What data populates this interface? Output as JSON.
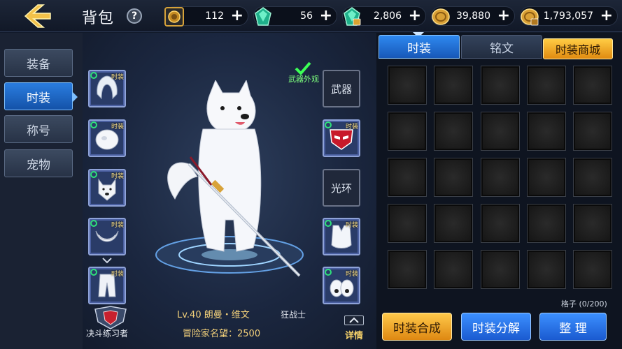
{
  "header": {
    "title": "背包",
    "help_label": "?",
    "currencies": [
      {
        "icon": "coin-badge-icon",
        "value": "112"
      },
      {
        "icon": "green-gem-icon",
        "value": "56"
      },
      {
        "icon": "bound-green-gem-icon",
        "value": "2,806"
      },
      {
        "icon": "gold-coin-icon",
        "value": "39,880"
      },
      {
        "icon": "bound-gold-coin-icon",
        "value": "1,793,057"
      }
    ],
    "plus_label": "+"
  },
  "nav": {
    "items": [
      {
        "label": "装备",
        "active": false
      },
      {
        "label": "时装",
        "active": true
      },
      {
        "label": "称号",
        "active": false
      },
      {
        "label": "宠物",
        "active": false
      }
    ]
  },
  "stage": {
    "slot_tag": "时装",
    "weapon_slot_label": "武器",
    "aura_slot_label": "光环",
    "weapon_look_label": "武器外观",
    "character_name": "Lv.40 朗曼・维文",
    "character_class": "狂战士",
    "reputation": "冒险家名望：2500",
    "detail_label": "详情",
    "rank_label": "决斗练习者"
  },
  "inventory": {
    "tabs": [
      {
        "label": "时装",
        "active": true
      },
      {
        "label": "铭文",
        "active": false
      }
    ],
    "shop_label": "时装商城",
    "capacity": "格子 (0/200)",
    "buttons": [
      {
        "label": "时装合成",
        "style": "gold"
      },
      {
        "label": "时装分解",
        "style": "blue"
      },
      {
        "label": "整 理",
        "style": "blue"
      }
    ]
  }
}
